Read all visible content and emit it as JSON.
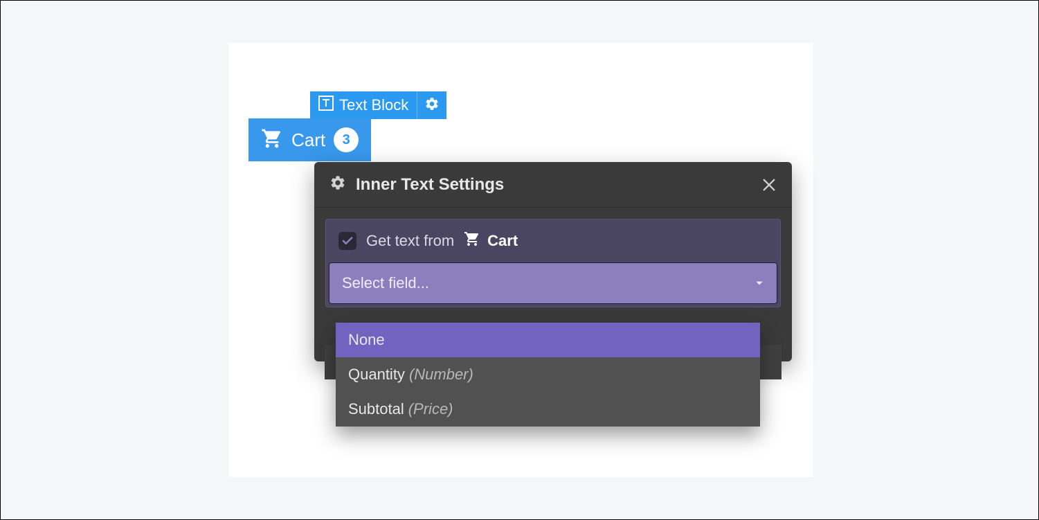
{
  "elementLabel": {
    "name": "Text Block"
  },
  "cartChip": {
    "label": "Cart",
    "badgeCount": "3"
  },
  "settingsPanel": {
    "title": "Inner Text Settings",
    "getTextLabel": "Get text from",
    "sourceRef": "Cart",
    "selectPlaceholder": "Select field..."
  },
  "dropdown": {
    "options": [
      {
        "label": "None",
        "type": "",
        "highlighted": true
      },
      {
        "label": "Quantity",
        "type": "(Number)",
        "highlighted": false
      },
      {
        "label": "Subtotal",
        "type": "(Price)",
        "highlighted": false
      }
    ]
  }
}
